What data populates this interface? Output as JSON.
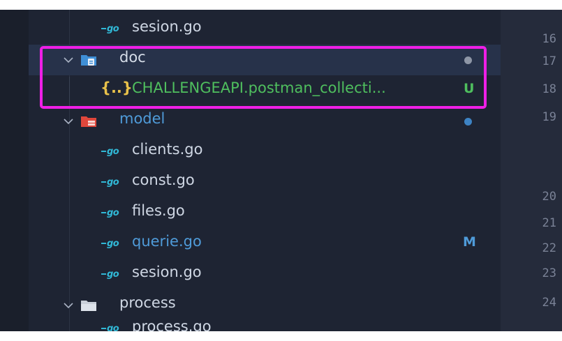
{
  "explorer": {
    "rows": [
      {
        "label": "sesion.go",
        "type": "file",
        "icon": "go-file-icon"
      },
      {
        "label": "doc",
        "type": "folder",
        "icon": "folder-doc-icon",
        "expanded": true
      },
      {
        "label": "CHALLENGEAPI.postman_collecti...",
        "type": "file",
        "icon": "json-file-icon",
        "badge": "U"
      },
      {
        "label": "model",
        "type": "folder",
        "icon": "folder-model-icon",
        "expanded": true
      },
      {
        "label": "clients.go",
        "type": "file",
        "icon": "go-file-icon"
      },
      {
        "label": "const.go",
        "type": "file",
        "icon": "go-file-icon"
      },
      {
        "label": "files.go",
        "type": "file",
        "icon": "go-file-icon"
      },
      {
        "label": "querie.go",
        "type": "file",
        "icon": "go-file-icon",
        "badge": "M"
      },
      {
        "label": "sesion.go",
        "type": "file",
        "icon": "go-file-icon"
      },
      {
        "label": "process",
        "type": "folder",
        "icon": "folder-icon",
        "expanded": true
      },
      {
        "label": "process.go",
        "type": "file",
        "icon": "go-file-icon"
      }
    ],
    "go_icon_text": "GO",
    "json_icon_text": "{..}"
  },
  "editor": {
    "line_numbers": [
      "16",
      "17",
      "18",
      "19",
      "20",
      "21",
      "22",
      "23",
      "24"
    ]
  },
  "colors": {
    "explorer_bg": "#1e2433",
    "selected_row_bg": "#27324a",
    "untracked_green": "#4fbf5e",
    "modified_blue": "#4f9bd9",
    "highlight_magenta": "#ee1fe6",
    "go_icon_cyan": "#31b8d6",
    "json_icon_yellow": "#e8c14a"
  }
}
